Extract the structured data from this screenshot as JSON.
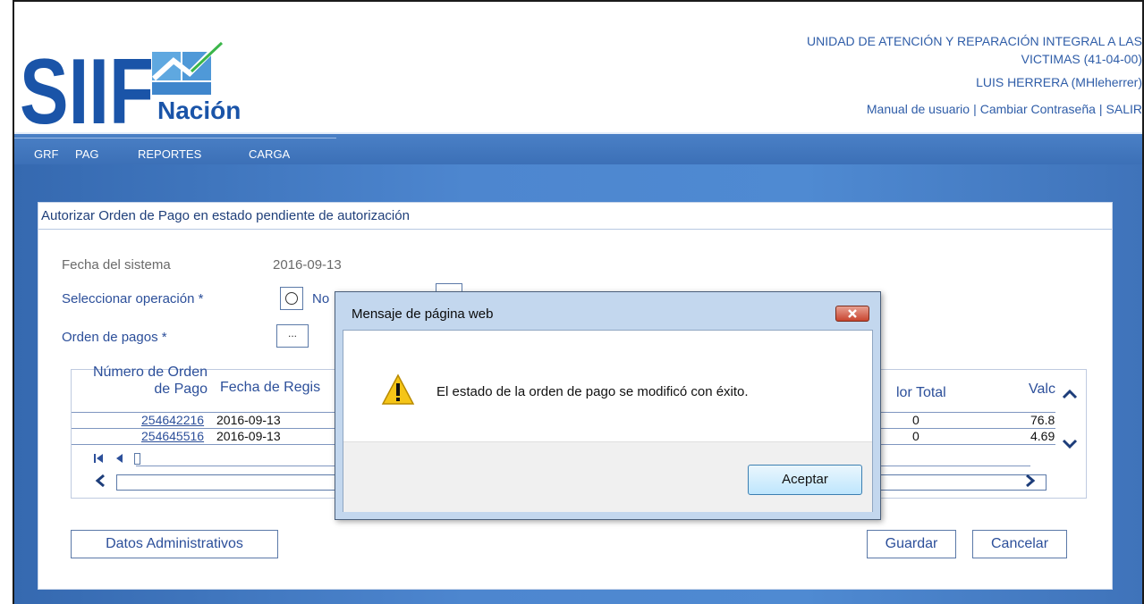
{
  "header": {
    "logo_text": "SIIF",
    "logo_sub": "Nación",
    "org_line1": "UNIDAD DE ATENCIÓN Y REPARACIÓN INTEGRAL A LAS",
    "org_line2": "VICTIMAS (41-04-00)",
    "user": "LUIS HERRERA (MHleherrer)",
    "links": {
      "manual": "Manual de usuario",
      "password": "Cambiar Contraseña",
      "exit": "SALIR",
      "sep": "|"
    }
  },
  "menu": [
    "GRF",
    "PAG",
    "REPORTES",
    "CARGA"
  ],
  "panel": {
    "title": "Autorizar Orden de Pago en estado pendiente de autorización",
    "fecha_label": "Fecha del sistema",
    "fecha_value": "2016-09-13",
    "operacion_label": "Seleccionar operación *",
    "operacion_option": "No",
    "orden_label": "Orden de pagos *",
    "orden_button": "..."
  },
  "grid": {
    "col_numero_1": "Número de Orden",
    "col_numero_2": "de Pago",
    "col_fecha": "Fecha de Regis",
    "col_valor_total": "lor Total",
    "col_valor": "Valc",
    "rows": [
      {
        "numero": "254642216",
        "fecha": "2016-09-13",
        "valor_total": "0",
        "valor": "76.8"
      },
      {
        "numero": "254645516",
        "fecha": "2016-09-13",
        "valor_total": "0",
        "valor": "4.69"
      }
    ],
    "pager_first": "I◀",
    "pager_prev": "◀",
    "scroll_left": "<",
    "scroll_right": ">",
    "scroll_up": "^",
    "scroll_down": "v"
  },
  "buttons": {
    "datos": "Datos Administrativos",
    "guardar": "Guardar",
    "cancelar": "Cancelar"
  },
  "dialog": {
    "title": "Mensaje de página web",
    "close": "x",
    "message": "El estado de la orden de pago se modificó con éxito.",
    "ok": "Aceptar",
    "icon": "warning-icon"
  }
}
